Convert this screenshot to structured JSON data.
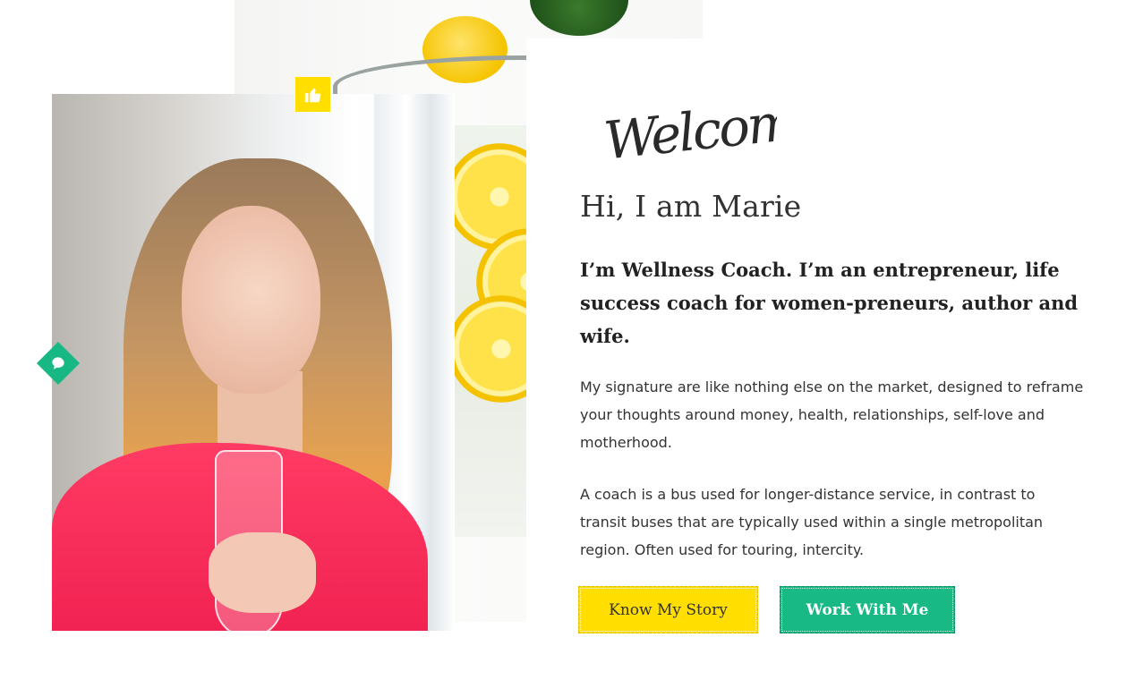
{
  "welcome_script": "Welcome",
  "heading": "Hi, I am Marie",
  "subheading": "I’m Wellness Coach. I’m an entrepreneur, life success coach for women-preneurs, author and wife.",
  "paragraphs": [
    "My signature are like nothing else on the market, designed to reframe your thoughts around money, health, relationships, self-love and motherhood.",
    "A coach is a bus used for longer-distance service, in contrast to transit buses that are typically used within a single metropolitan region. Often used for touring, intercity."
  ],
  "buttons": {
    "know_story": "Know My Story",
    "work_with_me": "Work With Me"
  },
  "icons": {
    "thumb_badge": "thumbs-up-icon",
    "chat_badge": "chat-bubble-icon"
  },
  "colors": {
    "accent_yellow": "#ffde00",
    "accent_green": "#18b984",
    "text_dark": "#333333"
  }
}
